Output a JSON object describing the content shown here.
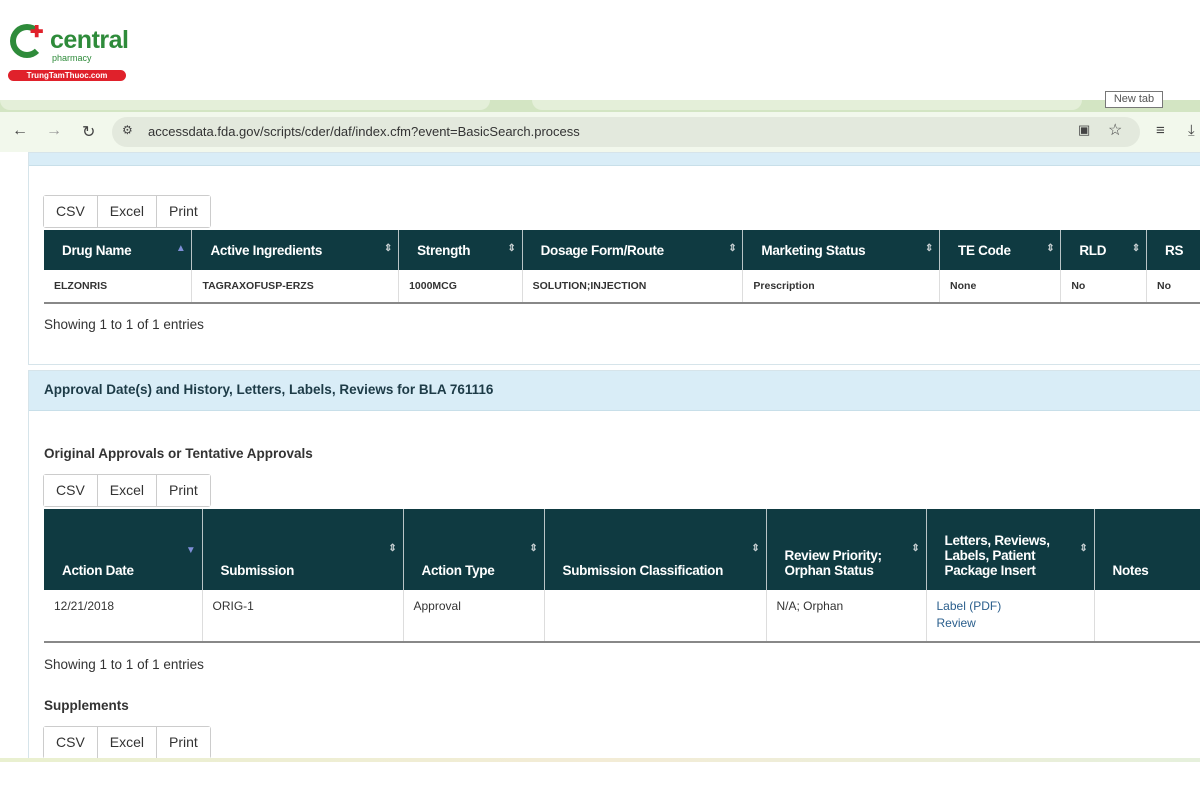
{
  "logo": {
    "brand": "central",
    "sub": "pharmacy",
    "site": "TrungTamThuoc.com"
  },
  "browser": {
    "tooltip": "New tab",
    "url": "accessdata.fda.gov/scripts/cder/daf/index.cfm?event=BasicSearch.process",
    "icons": [
      "back-arrow",
      "forward-arrow",
      "reload",
      "site-settings",
      "translate",
      "bookmark-star",
      "reading-list",
      "download"
    ]
  },
  "export_buttons": [
    "CSV",
    "Excel",
    "Print"
  ],
  "products": {
    "headers": [
      "Drug Name",
      "Active Ingredients",
      "Strength",
      "Dosage Form/Route",
      "Marketing Status",
      "TE Code",
      "RLD",
      "RS"
    ],
    "rows": [
      [
        "ELZONRIS",
        "TAGRAXOFUSP-ERZS",
        "1000MCG",
        "SOLUTION;INJECTION",
        "Prescription",
        "None",
        "No",
        "No"
      ]
    ],
    "info": "Showing 1 to 1 of 1 entries"
  },
  "history": {
    "title": "Approval Date(s) and History, Letters, Labels, Reviews for BLA 761116",
    "original_title": "Original Approvals or Tentative Approvals",
    "headers": [
      "Action Date",
      "Submission",
      "Action Type",
      "Submission Classification",
      "Review Priority; Orphan Status",
      "Letters, Reviews, Labels, Patient Package Insert",
      "Notes"
    ],
    "row": {
      "date": "12/21/2018",
      "submission": "ORIG-1",
      "action_type": "Approval",
      "classification": "",
      "priority": "N/A; Orphan",
      "links": [
        "Label (PDF)",
        "Review"
      ],
      "notes": ""
    },
    "info": "Showing 1 to 1 of 1 entries",
    "supplements_title": "Supplements"
  },
  "colors": {
    "table_header": "#0f3a41",
    "panel_header": "#d9edf7",
    "link": "#2a5e8c",
    "brand_green": "#2e8b3a",
    "brand_red": "#e0212b"
  }
}
